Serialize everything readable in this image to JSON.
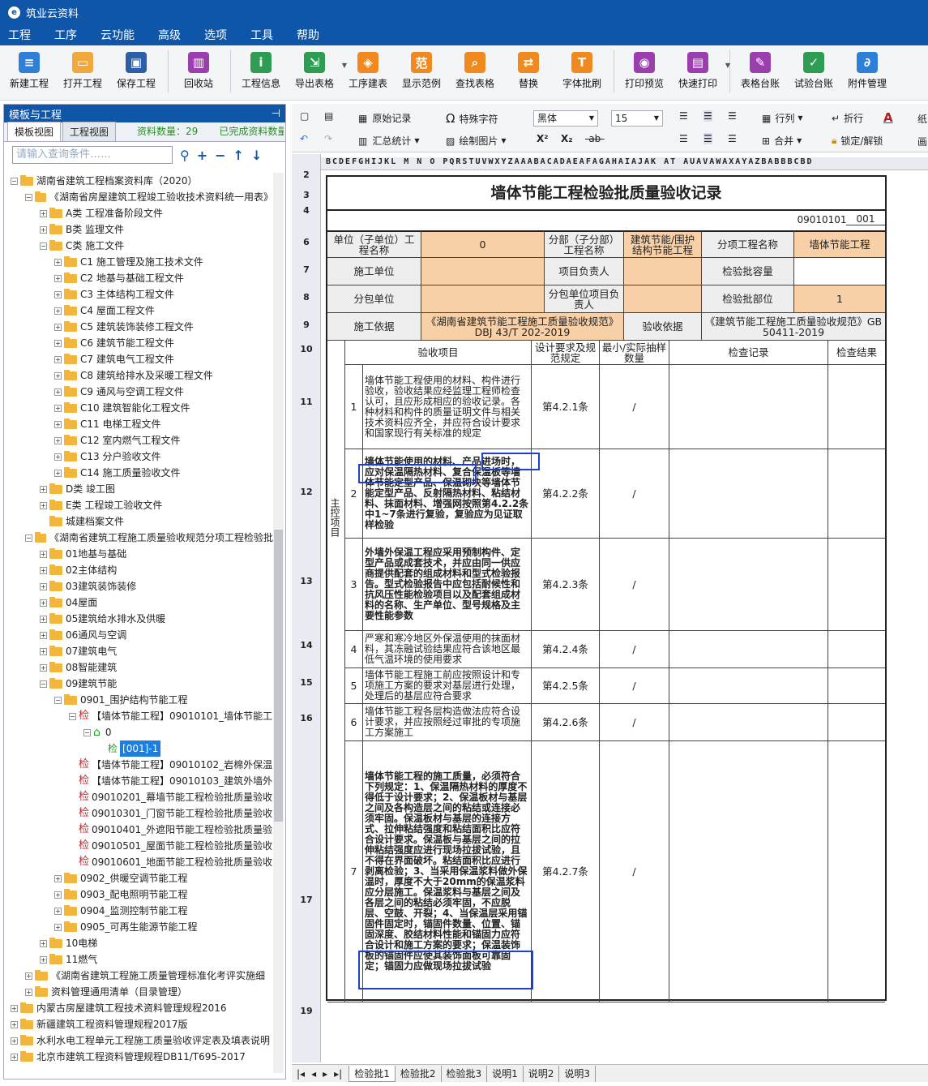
{
  "window_title": "筑业云资料",
  "menu": [
    "工程",
    "工序",
    "云功能",
    "高级",
    "选项",
    "工具",
    "帮助"
  ],
  "toolbar": [
    {
      "label": "新建工程",
      "icon": "new-project-icon",
      "color": "#2d7fd8",
      "glyph": "≡"
    },
    {
      "label": "打开工程",
      "icon": "open-folder-icon",
      "color": "#f2a93b",
      "glyph": "▭"
    },
    {
      "label": "保存工程",
      "icon": "save-icon",
      "color": "#2d5fa8",
      "glyph": "▣"
    },
    {
      "label": "回收站",
      "icon": "trash-icon",
      "color": "#9b3fae",
      "glyph": "▥"
    },
    {
      "label": "工程信息",
      "icon": "info-icon",
      "color": "#2e9c52",
      "glyph": "i"
    },
    {
      "label": "导出表格",
      "icon": "export-icon",
      "color": "#2e9c52",
      "glyph": "⇲"
    },
    {
      "label": "工序建表",
      "icon": "layers-icon",
      "color": "#f08a20",
      "glyph": "◈"
    },
    {
      "label": "显示范例",
      "icon": "example-icon",
      "color": "#f08a20",
      "glyph": "范"
    },
    {
      "label": "查找表格",
      "icon": "search-table-icon",
      "color": "#f08a20",
      "glyph": "⌕"
    },
    {
      "label": "替换",
      "icon": "replace-icon",
      "color": "#f08a20",
      "glyph": "⇄"
    },
    {
      "label": "字体批刷",
      "icon": "font-brush-icon",
      "color": "#f08a20",
      "glyph": "T"
    },
    {
      "label": "打印预览",
      "icon": "print-preview-icon",
      "color": "#9b3fae",
      "glyph": "◉"
    },
    {
      "label": "快速打印",
      "icon": "print-icon",
      "color": "#9b3fae",
      "glyph": "▤"
    },
    {
      "label": "表格台账",
      "icon": "ledger-icon",
      "color": "#9b3fae",
      "glyph": "✎"
    },
    {
      "label": "试验台账",
      "icon": "test-ledger-icon",
      "color": "#2e9c52",
      "glyph": "✓"
    },
    {
      "label": "附件管理",
      "icon": "attachment-icon",
      "color": "#2d7fd8",
      "glyph": "∂"
    }
  ],
  "left_panel": {
    "title": "模板与工程",
    "pin": "⊣",
    "tabs": [
      "模板视图",
      "工程视图"
    ],
    "count_label": "资料数量：29",
    "status_label": "已完成资料数量",
    "search_placeholder": "请输入查询条件……",
    "tree": [
      {
        "level": 0,
        "label": "湖南省建筑工程档案资料库（2020）",
        "toggle": "−",
        "type": "folder"
      },
      {
        "level": 1,
        "label": "《湖南省房屋建筑工程竣工验收技术资料统一用表》",
        "toggle": "−",
        "type": "folder"
      },
      {
        "level": 2,
        "label": "A类 工程准备阶段文件",
        "toggle": "+",
        "type": "folder"
      },
      {
        "level": 2,
        "label": "B类 监理文件",
        "toggle": "+",
        "type": "folder"
      },
      {
        "level": 2,
        "label": "C类 施工文件",
        "toggle": "−",
        "type": "folder"
      },
      {
        "level": 3,
        "label": "C1 施工管理及施工技术文件",
        "toggle": "+",
        "type": "folder"
      },
      {
        "level": 3,
        "label": "C2 地基与基础工程文件",
        "toggle": "+",
        "type": "folder"
      },
      {
        "level": 3,
        "label": "C3 主体结构工程文件",
        "toggle": "+",
        "type": "folder"
      },
      {
        "level": 3,
        "label": "C4 屋面工程文件",
        "toggle": "+",
        "type": "folder"
      },
      {
        "level": 3,
        "label": "C5 建筑装饰装修工程文件",
        "toggle": "+",
        "type": "folder"
      },
      {
        "level": 3,
        "label": "C6 建筑节能工程文件",
        "toggle": "+",
        "type": "folder"
      },
      {
        "level": 3,
        "label": "C7 建筑电气工程文件",
        "toggle": "+",
        "type": "folder"
      },
      {
        "level": 3,
        "label": "C8 建筑给排水及采暖工程文件",
        "toggle": "+",
        "type": "folder"
      },
      {
        "level": 3,
        "label": "C9 通风与空调工程文件",
        "toggle": "+",
        "type": "folder"
      },
      {
        "level": 3,
        "label": "C10 建筑智能化工程文件",
        "toggle": "+",
        "type": "folder"
      },
      {
        "level": 3,
        "label": "C11 电梯工程文件",
        "toggle": "+",
        "type": "folder"
      },
      {
        "level": 3,
        "label": "C12 室内燃气工程文件",
        "toggle": "+",
        "type": "folder"
      },
      {
        "level": 3,
        "label": "C13 分户验收文件",
        "toggle": "+",
        "type": "folder"
      },
      {
        "level": 3,
        "label": "C14 施工质量验收文件",
        "toggle": "+",
        "type": "folder"
      },
      {
        "level": 2,
        "label": "D类 竣工图",
        "toggle": "+",
        "type": "folder"
      },
      {
        "level": 2,
        "label": "E类 工程竣工验收文件",
        "toggle": "+",
        "type": "folder"
      },
      {
        "level": 2,
        "label": "城建档案文件",
        "toggle": "",
        "type": "folder"
      },
      {
        "level": 1,
        "label": "《湖南省建筑工程施工质量验收规范分项工程检验批",
        "toggle": "−",
        "type": "folder"
      },
      {
        "level": 2,
        "label": "01地基与基础",
        "toggle": "+",
        "type": "folder"
      },
      {
        "level": 2,
        "label": "02主体结构",
        "toggle": "+",
        "type": "folder"
      },
      {
        "level": 2,
        "label": "03建筑装饰装修",
        "toggle": "+",
        "type": "folder"
      },
      {
        "level": 2,
        "label": "04屋面",
        "toggle": "+",
        "type": "folder"
      },
      {
        "level": 2,
        "label": "05建筑给水排水及供暖",
        "toggle": "+",
        "type": "folder"
      },
      {
        "level": 2,
        "label": "06通风与空调",
        "toggle": "+",
        "type": "folder"
      },
      {
        "level": 2,
        "label": "07建筑电气",
        "toggle": "+",
        "type": "folder"
      },
      {
        "level": 2,
        "label": "08智能建筑",
        "toggle": "+",
        "type": "folder"
      },
      {
        "level": 2,
        "label": "09建筑节能",
        "toggle": "−",
        "type": "folder"
      },
      {
        "level": 3,
        "label": "0901_围护结构节能工程",
        "toggle": "−",
        "type": "folder"
      },
      {
        "level": 4,
        "label": "【墙体节能工程】09010101_墙体节能工",
        "toggle": "−",
        "type": "jian"
      },
      {
        "level": 5,
        "label": "0",
        "toggle": "−",
        "type": "home"
      },
      {
        "level": 6,
        "label": "[001]-1",
        "toggle": "",
        "type": "selected"
      },
      {
        "level": 4,
        "label": "【墙体节能工程】09010102_岩棉外保温",
        "toggle": "",
        "type": "jian"
      },
      {
        "level": 4,
        "label": "【墙体节能工程】09010103_建筑外墙外",
        "toggle": "",
        "type": "jian"
      },
      {
        "level": 4,
        "label": "09010201_幕墙节能工程检验批质量验收",
        "toggle": "",
        "type": "jian"
      },
      {
        "level": 4,
        "label": "09010301_门窗节能工程检验批质量验收",
        "toggle": "",
        "type": "jian"
      },
      {
        "level": 4,
        "label": "09010401_外遮阳节能工程检验批质量验",
        "toggle": "",
        "type": "jian"
      },
      {
        "level": 4,
        "label": "09010501_屋面节能工程检验批质量验收",
        "toggle": "",
        "type": "jian"
      },
      {
        "level": 4,
        "label": "09010601_地面节能工程检验批质量验收",
        "toggle": "",
        "type": "jian"
      },
      {
        "level": 3,
        "label": "0902_供暖空调节能工程",
        "toggle": "+",
        "type": "folder"
      },
      {
        "level": 3,
        "label": "0903_配电照明节能工程",
        "toggle": "+",
        "type": "folder"
      },
      {
        "level": 3,
        "label": "0904_监测控制节能工程",
        "toggle": "+",
        "type": "folder"
      },
      {
        "level": 3,
        "label": "0905_可再生能源节能工程",
        "toggle": "+",
        "type": "folder"
      },
      {
        "level": 2,
        "label": "10电梯",
        "toggle": "+",
        "type": "folder"
      },
      {
        "level": 2,
        "label": "11燃气",
        "toggle": "+",
        "type": "folder"
      },
      {
        "level": 1,
        "label": "《湖南省建筑工程施工质量管理标准化考评实施细",
        "toggle": "+",
        "type": "folder"
      },
      {
        "level": 1,
        "label": "资料管理通用清单（目录管理）",
        "toggle": "+",
        "type": "folder"
      },
      {
        "level": 0,
        "label": "内蒙古房屋建筑工程技术资料管理规程2016",
        "toggle": "+",
        "type": "folder"
      },
      {
        "level": 0,
        "label": "新疆建筑工程资料管理规程2017版",
        "toggle": "+",
        "type": "folder"
      },
      {
        "level": 0,
        "label": "水利水电工程单元工程施工质量验收评定表及填表说明",
        "toggle": "+",
        "type": "folder"
      },
      {
        "level": 0,
        "label": "北京市建筑工程资料管理规程DB11/T695-2017",
        "toggle": "+",
        "type": "folder"
      }
    ]
  },
  "format_toolbar": {
    "original_record": "原始记录",
    "summary": "汇总统计",
    "special_char": "特殊字符",
    "draw_image": "绘制图片",
    "font": "黑体",
    "size": "15",
    "row_col": "行列",
    "merge": "合并",
    "wrap": "折行",
    "lock": "锁定/解锁",
    "more": "纸",
    "more2": "画"
  },
  "col_letters": "BCDEFGHIJKL M N O PQRSTUVWXYZAAABACADAEAFAGAHAIAJAK AT AUAVAWAXAYAZBABBBCBD",
  "row_numbers": [
    "2",
    "3",
    "4",
    "6",
    "7",
    "8",
    "9",
    "10",
    "11",
    "12",
    "13",
    "14",
    "15",
    "16",
    "17",
    "19"
  ],
  "sheet": {
    "title": "墙体节能工程检验批质量验收记录",
    "code": "09010101",
    "code_no": "001",
    "unit_label": "单位（子单位）工程名称",
    "unit_value": "0",
    "branch_label": "分部（子分部）工程名称",
    "branch_value": "建筑节能/围护结构节能工程",
    "sub_label": "分项工程名称",
    "sub_value": "墙体节能工程",
    "builder_label": "施工单位",
    "builder_value": "",
    "pm_label": "项目负责人",
    "pm_value": "",
    "capacity_label": "检验批容量",
    "capacity_value": "",
    "subcon_label": "分包单位",
    "subcon_value": "",
    "subcon_pm_label": "分包单位项目负责人",
    "subcon_pm_value": "",
    "part_label": "检验批部位",
    "part_value": "1",
    "basis_label": "施工依据",
    "basis_value": "《湖南省建筑节能工程施工质量验收规范》DBJ 43/T 202-2019",
    "accept_basis_label": "验收依据",
    "accept_basis_value": "《建筑节能工程施工质量验收规范》GB 50411-2019",
    "h_item": "验收项目",
    "h_design": "设计要求及规范规定",
    "h_min": "最小/实际抽样数量",
    "h_record": "检查记录",
    "h_result": "检查结果",
    "main_label": "主控项目",
    "items": [
      {
        "no": "1",
        "text": "墙体节能工程使用的材料、构件进行验收，验收结果应经监理工程师检查认可，且应形成相应的验收记录。各种材料和构件的质量证明文件与相关技术资料应齐全，并应符合设计要求和国家现行有关标准的规定",
        "clause": "第4.2.1条",
        "sample": "/",
        "bold": false
      },
      {
        "no": "2",
        "text": "墙体节能使用的材料、产品进场时，应对保温隔热材料、复合保温板等墙体节能定型产品、保温砌块等墙体节能定型产品、反射隔热材料、粘结材料、抹面材料、增强网按照第4.2.2条中1~7条进行复验，复验应为见证取样检验",
        "clause": "第4.2.2条",
        "sample": "/",
        "bold": true
      },
      {
        "no": "3",
        "text": "外墙外保温工程应采用预制构件、定型产品或成套技术，并应由同一供应商提供配套的组成材料和型式检验报告。型式检验报告中应包括耐候性和抗风压性能检验项目以及配套组成材料的名称、生产单位、型号规格及主要性能参数",
        "clause": "第4.2.3条",
        "sample": "/",
        "bold": true
      },
      {
        "no": "4",
        "text": "严寒和寒冷地区外保温使用的抹面材料，其冻融试验结果应符合该地区最低气温环境的使用要求",
        "clause": "第4.2.4条",
        "sample": "/",
        "bold": false
      },
      {
        "no": "5",
        "text": "墙体节能工程施工前应按照设计和专项施工方案的要求对基层进行处理，处理后的基层应符合要求",
        "clause": "第4.2.5条",
        "sample": "/",
        "bold": false
      },
      {
        "no": "6",
        "text": "墙体节能工程各层构造做法应符合设计要求，并应按照经过审批的专项施工方案施工",
        "clause": "第4.2.6条",
        "sample": "/",
        "bold": false
      },
      {
        "no": "7",
        "text": "墙体节能工程的施工质量，必须符合下列规定：1、保温隔热材料的厚度不得低于设计要求；2、保温板材与基层之间及各构造层之间的粘结或连接必须牢固。保温板材与基层的连接方式、拉伸粘结强度和粘结面积比应符合设计要求。保温板与基层之间的拉伸粘结强度应进行现场拉拔试验，且不得在界面破坏。粘结面积比应进行剥离检验；3、当采用保温浆料做外保温时，厚度不大于20mm的保温浆料应分层施工。保温浆料与基层之间及各层之间的粘结必须牢固，不应脱层、空鼓、开裂；4、当保温层采用锚固件固定时，锚固件数量、位置、锚固深度、胶结材料性能和锚固力应符合设计和施工方案的要求；保温装饰板的锚固件应使其装饰面板可靠固定；锚固力应做现场拉拔试验",
        "clause": "第4.2.7条",
        "sample": "/",
        "bold": true
      }
    ]
  },
  "sheet_tabs": [
    "检验批1",
    "检验批2",
    "检验批3",
    "说明1",
    "说明2",
    "说明3"
  ]
}
